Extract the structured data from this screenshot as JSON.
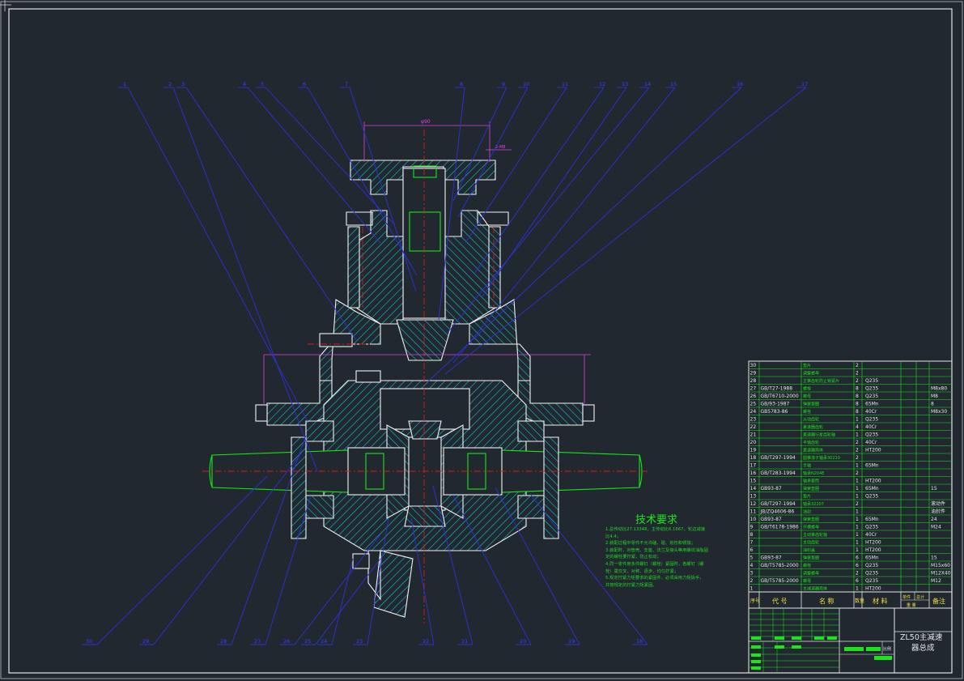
{
  "technical_requirements": {
    "title": "技术要求",
    "notes": [
      "1.总传动比27.13348，主传动比6.1667，轮边减速",
      "比4.4；",
      "2.装配过程中零件不允许磕、碰、划伤和锈蚀；",
      "3.装配时，对管壳、支座、法兰及接头等用螺纹油脂固",
      "定的螺柱要拧紧，防止松动；",
      "4.同一零件用多件螺钉（螺栓）紧固时，各螺钉（螺",
      "栓）需交叉、对称、逐步、均匀拧紧；",
      "5.规定拧紧力矩要求的紧固件，必须采用力矩扳手，",
      "并按规定的拧紧力矩紧固。"
    ]
  },
  "balloon_top": [
    "1",
    "2",
    "3",
    "4",
    "5",
    "6",
    "7",
    "8",
    "9",
    "10",
    "11",
    "12",
    "13",
    "14",
    "15",
    "16",
    "17"
  ],
  "balloon_bottom": [
    "30",
    "29",
    "28",
    "27",
    "26",
    "25",
    "24",
    "23",
    "22",
    "21",
    "20",
    "19",
    "18"
  ],
  "dims": {
    "top_width": "φ90",
    "right_note": "2-M8"
  },
  "bom": {
    "rows": [
      {
        "no": "30",
        "code": "",
        "name": "垫片",
        "qty": "2",
        "material": "",
        "note": ""
      },
      {
        "no": "29",
        "code": "",
        "name": "调整螺母",
        "qty": "2",
        "material": "",
        "note": ""
      },
      {
        "no": "28",
        "code": "",
        "name": "主锥齿轮防止锁紧片",
        "qty": "2",
        "material": "Q235",
        "note": ""
      },
      {
        "no": "27",
        "code": "GB/T27-1988",
        "name": "螺栓",
        "qty": "8",
        "material": "Q235",
        "note": "M8x80"
      },
      {
        "no": "26",
        "code": "GB/T6710-2000",
        "name": "螺母",
        "qty": "8",
        "material": "Q235",
        "note": "M8"
      },
      {
        "no": "25",
        "code": "GB/93-1987",
        "name": "弹簧垫圈",
        "qty": "8",
        "material": "65Mn",
        "note": "8"
      },
      {
        "no": "24",
        "code": "GB5783-86",
        "name": "螺栓",
        "qty": "8",
        "material": "40Cr",
        "note": "M8x30"
      },
      {
        "no": "23",
        "code": "",
        "name": "从动齿轮",
        "qty": "1",
        "material": "Q235",
        "note": ""
      },
      {
        "no": "22",
        "code": "",
        "name": "差速器齿轮",
        "qty": "4",
        "material": "40Cr",
        "note": ""
      },
      {
        "no": "21",
        "code": "",
        "name": "差速器行星齿轮轴",
        "qty": "1",
        "material": "Q235",
        "note": ""
      },
      {
        "no": "20",
        "code": "",
        "name": "半轴齿轮",
        "qty": "2",
        "material": "40Cr",
        "note": ""
      },
      {
        "no": "19",
        "code": "",
        "name": "差速器壳体",
        "qty": "2",
        "material": "HT200",
        "note": ""
      },
      {
        "no": "18",
        "code": "GB/T297-1994",
        "name": "圆锥滚子轴承30210",
        "qty": "2",
        "material": "",
        "note": ""
      },
      {
        "no": "17",
        "code": "",
        "name": "半轴",
        "qty": "1",
        "material": "65Mn",
        "note": ""
      },
      {
        "no": "16",
        "code": "GB/T283-1994",
        "name": "轴承N204E",
        "qty": "2",
        "material": "",
        "note": ""
      },
      {
        "no": "15",
        "code": "",
        "name": "轴承套筒",
        "qty": "1",
        "material": "HT200",
        "note": ""
      },
      {
        "no": "14",
        "code": "GB93-87",
        "name": "弹簧垫圈",
        "qty": "1",
        "material": "65Mn",
        "note": "15"
      },
      {
        "no": "13",
        "code": "",
        "name": "垫片",
        "qty": "1",
        "material": "Q235",
        "note": ""
      },
      {
        "no": "12",
        "code": "GB/T297-1994",
        "name": "轴承32207",
        "qty": "2",
        "material": "",
        "note": "滚动件"
      },
      {
        "no": "11",
        "code": "JB/ZQ4606-86",
        "name": "油封",
        "qty": "1",
        "material": "",
        "note": "油封件"
      },
      {
        "no": "10",
        "code": "GB93-87",
        "name": "弹簧垫圈",
        "qty": "1",
        "material": "65Mn",
        "note": "24"
      },
      {
        "no": "9",
        "code": "GB/T6178-1986",
        "name": "开槽螺母",
        "qty": "1",
        "material": "Q235",
        "note": "M24"
      },
      {
        "no": "8",
        "code": "",
        "name": "主动锥齿轮轴",
        "qty": "1",
        "material": "40Cr",
        "note": ""
      },
      {
        "no": "7",
        "code": "",
        "name": "主动齿轮",
        "qty": "1",
        "material": "HT200",
        "note": ""
      },
      {
        "no": "6",
        "code": "",
        "name": "油封盖",
        "qty": "1",
        "material": "HT200",
        "note": ""
      },
      {
        "no": "5",
        "code": "GB93-87",
        "name": "弹簧垫圈",
        "qty": "6",
        "material": "65Mn",
        "note": "15"
      },
      {
        "no": "4",
        "code": "GB/T5785-2000",
        "name": "螺栓",
        "qty": "6",
        "material": "Q235",
        "note": "M15x60"
      },
      {
        "no": "3",
        "code": "",
        "name": "调整螺母",
        "qty": "2",
        "material": "Q235",
        "note": "M12X40"
      },
      {
        "no": "2",
        "code": "GB/T5785-2000",
        "name": "螺母",
        "qty": "6",
        "material": "Q235",
        "note": "M12"
      },
      {
        "no": "1",
        "code": "",
        "name": "主减速器壳体",
        "qty": "1",
        "material": "HT200",
        "note": ""
      }
    ],
    "headers": {
      "no": "序号",
      "code": "代 号",
      "name": "名 称",
      "qty": "数量",
      "material": "材 料",
      "unit_weight": "单件",
      "total_weight": "总计",
      "weight": "重 量",
      "note": "备注"
    }
  },
  "title_block": {
    "title_line1": "ZL50主减速",
    "title_line2": "器总成",
    "scale_label": "比例"
  }
}
